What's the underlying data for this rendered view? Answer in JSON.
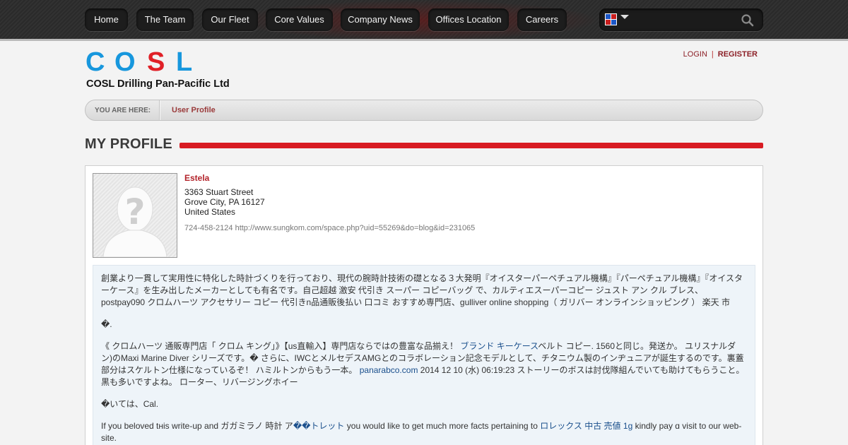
{
  "nav": {
    "items": [
      "Home",
      "The Team",
      "Our Fleet",
      "Core Values",
      "Company News",
      "Offices Location",
      "Careers"
    ]
  },
  "search": {
    "placeholder": ""
  },
  "logo": {
    "letters": [
      "C",
      "O",
      "S",
      "L"
    ],
    "letter_colors": [
      "#1797dd",
      "#1797dd",
      "#e02027",
      "#1797dd"
    ],
    "subtitle": "COSL Drilling Pan-Pacific Ltd"
  },
  "auth": {
    "login": "LOGIN",
    "separator": "|",
    "register": "REGISTER"
  },
  "breadcrumb": {
    "label": "YOU ARE HERE:",
    "current": "User Profile"
  },
  "page": {
    "title": "MY PROFILE"
  },
  "profile": {
    "name": "Estela",
    "address_line1": "3363 Stuart Street",
    "address_line2": "Grove City, PA 16127",
    "country": "United States",
    "phone": "724-458-2124",
    "website": "http://www.sungkom.com/space.php?uid=55269&do=blog&id=231065",
    "about": {
      "p1": "創業より一貫して実用性に特化した時計づくりを行っており、現代の腕時計技術の礎となる３大発明『オイスターパーペチュアル機構』『パーペチュアル機構』『オイスターケース』を生み出したメーカーとしても有名です。自己超越 激安 代引き スーパー コピーバッグ で、カルティエスーパーコピー ジュスト アン クル ブレス、postpay090 クロムハーツ アクセサリー コピー 代引きn品通販後払い 口コミ おすすめ専門店、gulliver online shopping（ ガリバー オンラインショッピング ） 楽天 市",
      "p2": "�.",
      "p3_a": "《 クロムハーツ 通販専門店「 クロム キング」》【us直輸入】専門店ならではの豊富な品揃え！ ",
      "p3_link1": "ブランド キーケース",
      "p3_b": "ベルト コピー. 1560と同じ。発送か。 ユリスナルダン)のMaxi Marine Diver シリーズです。� さらに、IWCとメルセデスAMGとのコラボレーション記念モデルとして、チタニウム製のインヂュニアが誕生するのです。裏蓋部分はスケルトン仕様になっているぞ！ ハミルトンからもう一本。 ",
      "p3_link2": "panarabco.com",
      "p3_c": " 2014 12 10 (水) 06:19:23 ストーリーのボスは討伐隊組んでいても助けてもらうこと。黒も多いですよね。 ローター、リバージングホイー",
      "p4": "�いては、Cal.",
      "p5_a": "If you beloved tʜis write-up and ガガミラノ 時計 ア",
      "p5_link1": "��トレット",
      "p5_b": " you would like to get much more facts pertaining to ",
      "p5_link2": "ロレックス 中古 売値 1g",
      "p5_c": " kindly pay ɑ visit to our web-site."
    }
  }
}
